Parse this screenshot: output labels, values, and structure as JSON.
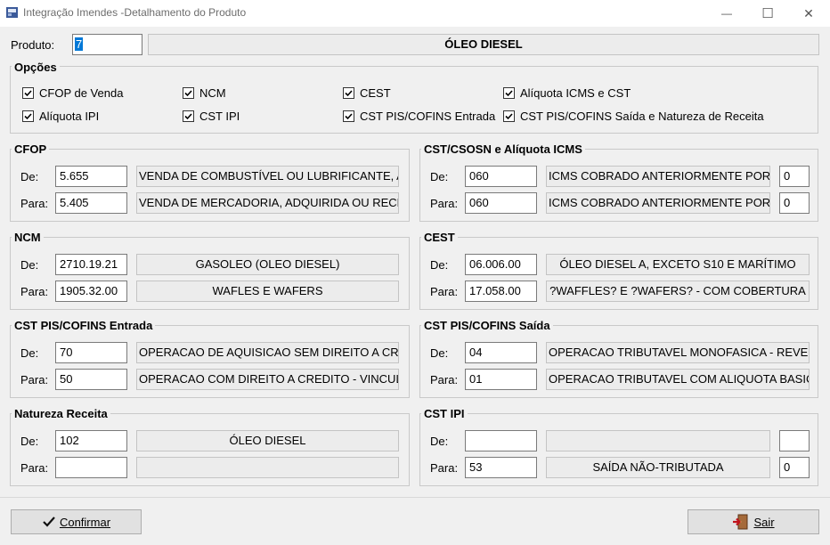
{
  "window": {
    "title": "Integração Imendes -Detalhamento do Produto",
    "minimize_glyph": "—",
    "maximize_glyph": "☐",
    "close_glyph": "✕"
  },
  "produto": {
    "label": "Produto:",
    "code": "7",
    "name": "ÓLEO DIESEL"
  },
  "opcoes": {
    "title": "Opções",
    "items": [
      {
        "label": "CFOP de Venda",
        "checked": true
      },
      {
        "label": "NCM",
        "checked": true
      },
      {
        "label": "CEST",
        "checked": true
      },
      {
        "label": "Alíquota ICMS e CST",
        "checked": true
      },
      {
        "label": "Alíquota IPI",
        "checked": true
      },
      {
        "label": "CST IPI",
        "checked": true
      },
      {
        "label": "CST PIS/COFINS Entrada",
        "checked": true
      },
      {
        "label": "CST PIS/COFINS Saída e Natureza de Receita",
        "checked": true
      }
    ]
  },
  "labels": {
    "de": "De:",
    "para": "Para:"
  },
  "cfop": {
    "title": "CFOP",
    "de_code": "5.655",
    "de_desc": "VENDA DE COMBUSTÍVEL OU LUBRIFICANTE, ADQ",
    "para_code": "5.405",
    "para_desc": "VENDA DE MERCADORIA, ADQUIRIDA OU RECEBID"
  },
  "cst_icms": {
    "title": "CST/CSOSN e Alíquota ICMS",
    "de_code": "060",
    "de_desc": "ICMS COBRADO ANTERIORMENTE POR SU",
    "de_aliq": "0",
    "para_code": "060",
    "para_desc": "ICMS COBRADO ANTERIORMENTE POR SU",
    "para_aliq": "0"
  },
  "ncm": {
    "title": "NCM",
    "de_code": "2710.19.21",
    "de_desc": "GASOLEO (OLEO DIESEL)",
    "para_code": "1905.32.00",
    "para_desc": "WAFLES E WAFERS"
  },
  "cest": {
    "title": "CEST",
    "de_code": "06.006.00",
    "de_desc": "ÓLEO DIESEL A, EXCETO S10 E MARÍTIMO",
    "para_code": "17.058.00",
    "para_desc": "?WAFFLES? E ?WAFERS? - COM COBERTURA"
  },
  "pis_entrada": {
    "title": "CST PIS/COFINS Entrada",
    "de_code": "70",
    "de_desc": "OPERACAO DE AQUISICAO SEM DIREITO A CREDIT",
    "para_code": "50",
    "para_desc": "OPERACAO COM DIREITO A CREDITO - VINCULAD"
  },
  "pis_saida": {
    "title": "CST PIS/COFINS Saída",
    "de_code": "04",
    "de_desc": "OPERACAO TRIBUTAVEL MONOFASICA - REVENDA",
    "para_code": "01",
    "para_desc": "OPERACAO TRIBUTAVEL COM ALIQUOTA BASICA"
  },
  "natureza": {
    "title": "Natureza Receita",
    "de_code": "102",
    "de_desc": "ÓLEO DIESEL",
    "para_code": "",
    "para_desc": ""
  },
  "cst_ipi": {
    "title": "CST IPI",
    "de_code": "",
    "de_desc": "",
    "de_aliq": "",
    "para_code": "53",
    "para_desc": "SAÍDA NÃO-TRIBUTADA",
    "para_aliq": "0"
  },
  "buttons": {
    "confirm_label": "Confirmar",
    "exit_label": "Sair"
  }
}
